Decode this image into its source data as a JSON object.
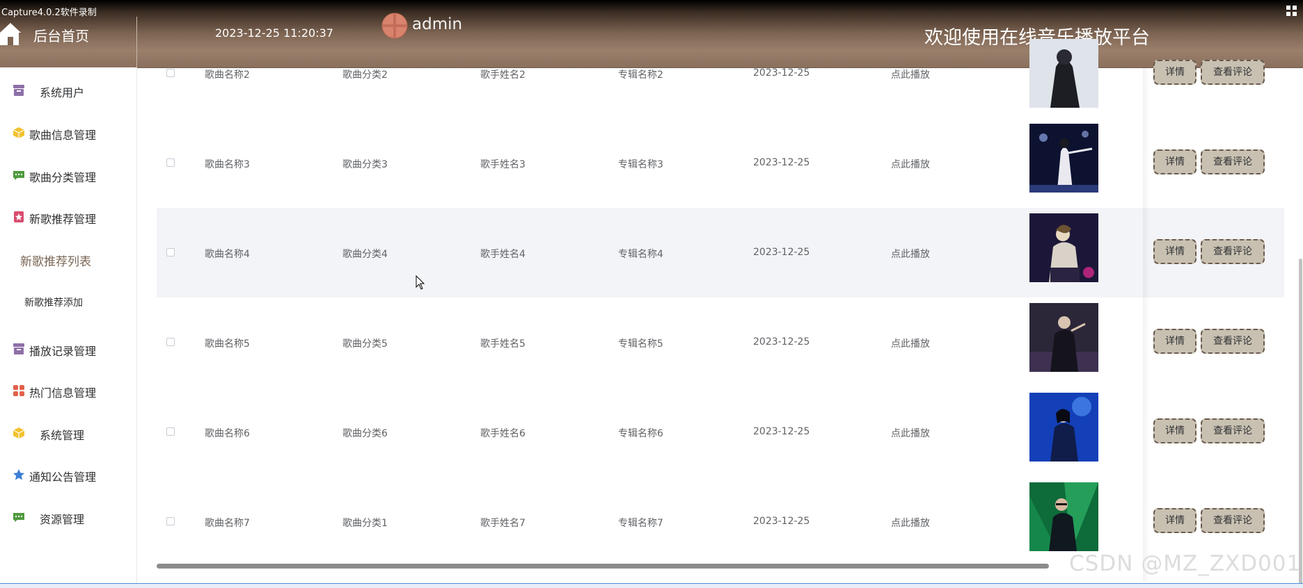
{
  "recorder_label": "Capture4.0.2软件录制",
  "header": {
    "home_label": "后台首页",
    "datetime": "2023-12-25 11:20:37",
    "username": "admin",
    "welcome": "欢迎使用在线音乐播放平台"
  },
  "sidebar": {
    "items": [
      {
        "label": "系统用户",
        "icon": "archive-icon",
        "color": "#8e6fa8"
      },
      {
        "label": "歌曲信息管理",
        "icon": "cube-icon",
        "color": "#f2c230"
      },
      {
        "label": "歌曲分类管理",
        "icon": "chat-icon",
        "color": "#4f9a3e"
      },
      {
        "label": "新歌推荐管理",
        "icon": "badge-icon",
        "color": "#d94c6e"
      },
      {
        "label": "播放记录管理",
        "icon": "archive-icon",
        "color": "#8e6fa8"
      },
      {
        "label": "热门信息管理",
        "icon": "grid-icon",
        "color": "#e0624a"
      },
      {
        "label": "系统管理",
        "icon": "cube-icon",
        "color": "#f2c230"
      },
      {
        "label": "通知公告管理",
        "icon": "star-icon",
        "color": "#3b7fd4"
      },
      {
        "label": "资源管理",
        "icon": "chat-icon",
        "color": "#4f9a3e"
      }
    ],
    "sub_items": [
      {
        "label": "新歌推荐列表",
        "active": true
      },
      {
        "label": "新歌推荐添加",
        "active": false
      }
    ]
  },
  "table": {
    "rows": [
      {
        "song": "歌曲名称2",
        "category": "歌曲分类2",
        "singer": "歌手姓名2",
        "album": "专辑名称2",
        "date": "2023-12-25",
        "play": "点此播放"
      },
      {
        "song": "歌曲名称3",
        "category": "歌曲分类3",
        "singer": "歌手姓名3",
        "album": "专辑名称3",
        "date": "2023-12-25",
        "play": "点此播放"
      },
      {
        "song": "歌曲名称4",
        "category": "歌曲分类4",
        "singer": "歌手姓名4",
        "album": "专辑名称4",
        "date": "2023-12-25",
        "play": "点此播放"
      },
      {
        "song": "歌曲名称5",
        "category": "歌曲分类5",
        "singer": "歌手姓名5",
        "album": "专辑名称5",
        "date": "2023-12-25",
        "play": "点此播放"
      },
      {
        "song": "歌曲名称6",
        "category": "歌曲分类6",
        "singer": "歌手姓名6",
        "album": "专辑名称6",
        "date": "2023-12-25",
        "play": "点此播放"
      },
      {
        "song": "歌曲名称7",
        "category": "歌曲分类1",
        "singer": "歌手姓名7",
        "album": "专辑名称7",
        "date": "2023-12-25",
        "play": "点此播放"
      }
    ],
    "detail_label": "详情",
    "comment_label": "查看评论"
  },
  "watermark": "CSDN @MZ_ZXD001",
  "colors": {
    "header_brown": "#8a705d",
    "button_bg": "#c8c1b2",
    "button_border": "#6b5a4e",
    "active_menu": "#7a6656"
  }
}
